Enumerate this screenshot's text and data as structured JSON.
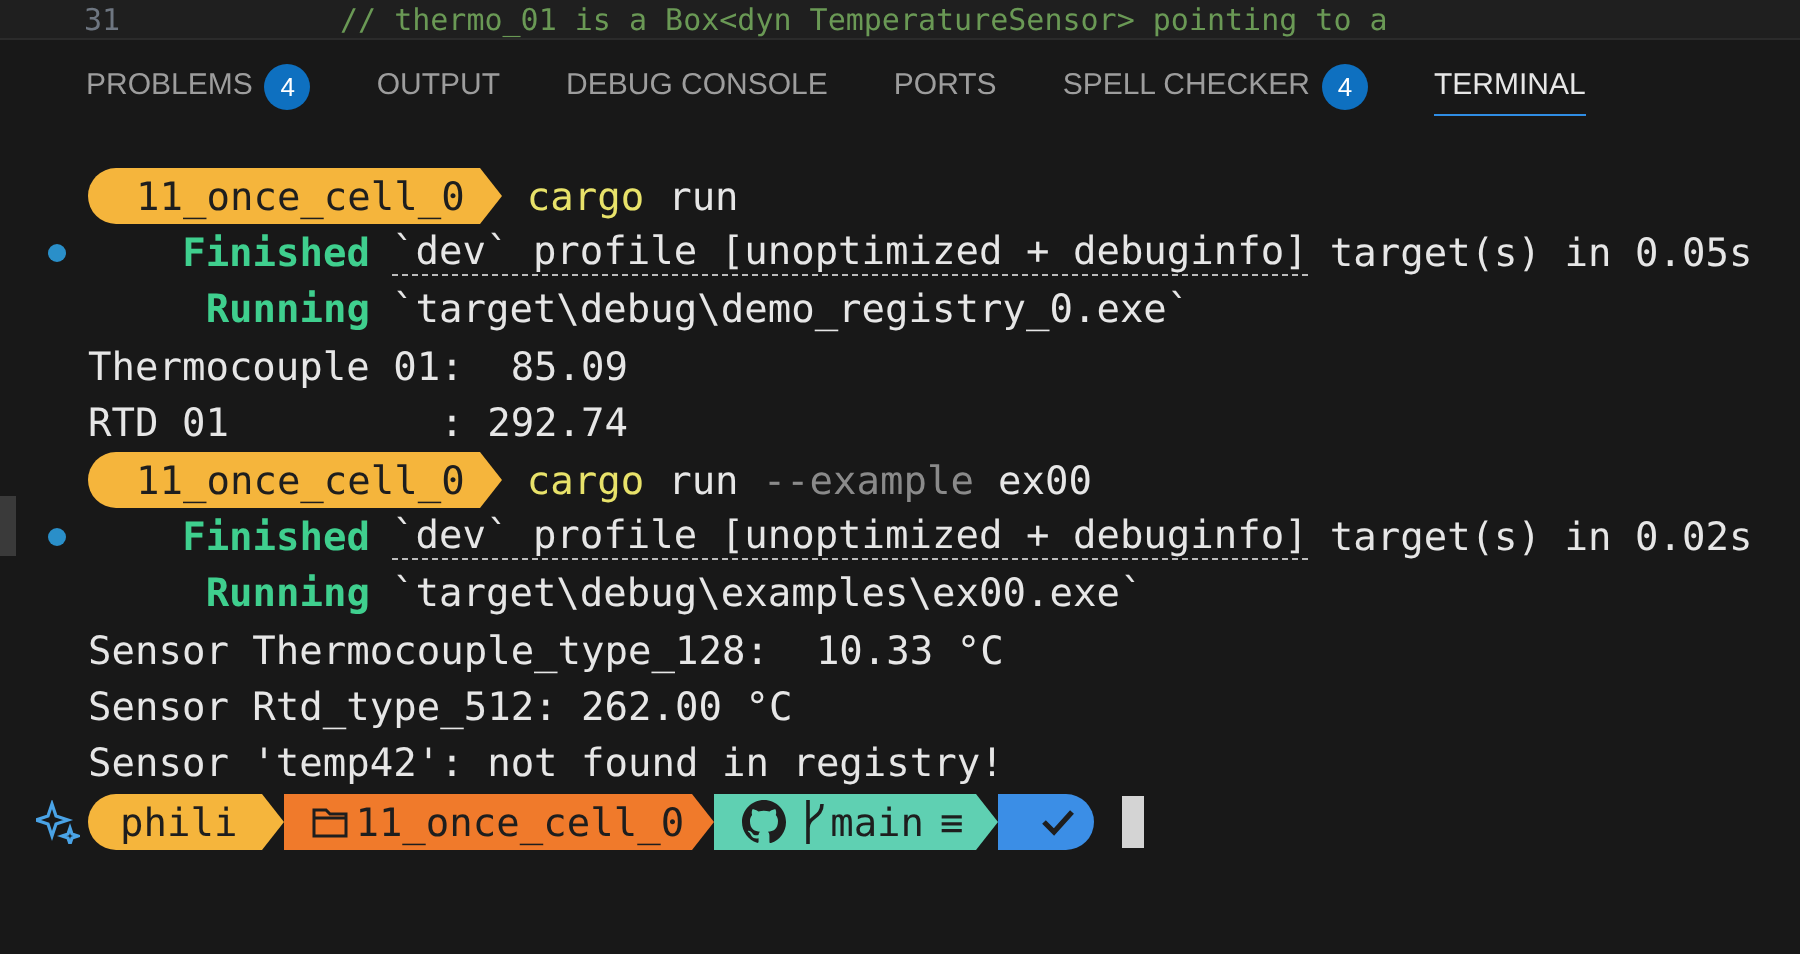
{
  "editor_line": {
    "number": "31",
    "code": "// thermo_01 is a Box<dyn TemperatureSensor> pointing to a"
  },
  "tabs": [
    {
      "label": "PROBLEMS",
      "badge": "4",
      "selected": false
    },
    {
      "label": "OUTPUT",
      "selected": false
    },
    {
      "label": "DEBUG CONSOLE",
      "selected": false
    },
    {
      "label": "PORTS",
      "selected": false
    },
    {
      "label": "SPELL CHECKER",
      "badge": "4",
      "selected": false
    },
    {
      "label": "TERMINAL",
      "selected": true
    }
  ],
  "terminal_lines": [
    {
      "kind": "prompt",
      "dir": "11_once_cell_0",
      "command": [
        {
          "kind": "program",
          "text": "cargo"
        },
        {
          "kind": "arg",
          "text": "run"
        }
      ]
    },
    {
      "kind": "status",
      "decorated": true,
      "label": "Finished",
      "linked": "`dev` profile [unoptimized + debuginfo]",
      "rest": "target(s) in 0.05s"
    },
    {
      "kind": "status",
      "decorated": false,
      "label": "Running",
      "rest": "`target\\debug\\demo_registry_0.exe`"
    },
    {
      "kind": "output",
      "text": "Thermocouple 01:  85.09"
    },
    {
      "kind": "output",
      "text": "RTD 01         : 292.74"
    },
    {
      "kind": "prompt",
      "dir": "11_once_cell_0",
      "command": [
        {
          "kind": "program",
          "text": "cargo"
        },
        {
          "kind": "arg",
          "text": "run"
        },
        {
          "kind": "flag",
          "text": "--example"
        },
        {
          "kind": "arg",
          "text": "ex00"
        }
      ]
    },
    {
      "kind": "status",
      "decorated": true,
      "label": "Finished",
      "linked": "`dev` profile [unoptimized + debuginfo]",
      "rest": "target(s) in 0.02s"
    },
    {
      "kind": "status",
      "decorated": false,
      "label": "Running",
      "rest": "`target\\debug\\examples\\ex00.exe`"
    },
    {
      "kind": "output",
      "text": "Sensor Thermocouple_type_128:  10.33 °C"
    },
    {
      "kind": "output",
      "text": "Sensor Rtd_type_512: 262.00 °C"
    },
    {
      "kind": "output",
      "text": "Sensor 'temp42': not found in registry!"
    }
  ],
  "shell_prompt": {
    "user": "phili",
    "folder": "11_once_cell_0",
    "branch": "main",
    "branch_status": "≡"
  }
}
